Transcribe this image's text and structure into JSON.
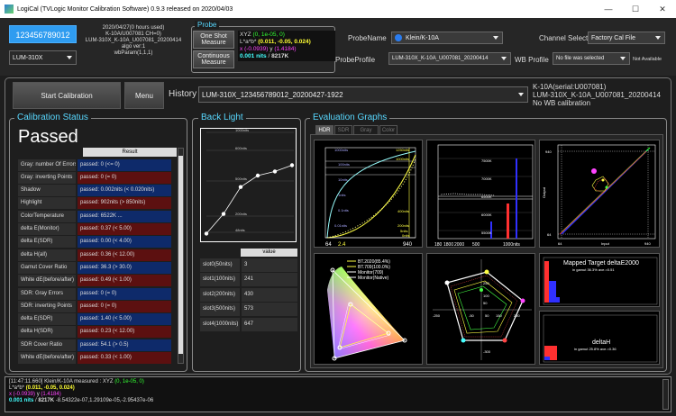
{
  "window": {
    "title": "LogiCal (TVLogic Monitor Calibration Software) 0.9.3 released on 2020/04/03"
  },
  "device": {
    "serial_button": "123456789012",
    "model": "LUM-310X",
    "info": [
      "2020/04/27(0 hours used)",
      "K-10A/U007081 CH=0)",
      "LUM-310X_K-10A_U007081_20200414",
      "algo ver:1",
      "wbParam(1,1,1)"
    ]
  },
  "probe": {
    "label": "Probe",
    "one_shot": "One Shot Measure",
    "continuous": "Continuous Measure",
    "line1_a": "XYZ ",
    "line1_b": "(0, 1e-05, 0)",
    "line2_a": "L*a*b* ",
    "line2_b": "(0.011, -0.05, 0.024)",
    "line3_a": "x ",
    "line3_b": "(-0.0939)",
    "line3_c": " y ",
    "line3_d": "(1.4184)",
    "line4_a": "0.001 nits",
    "line4_b": " / ",
    "line4_c": "8217K",
    "name_label": "ProbeName",
    "name_value": "Klein/K-10A",
    "profile_label": "ProbeProfile",
    "profile_value": "LUM-310X_K-10A_U007081_20200414",
    "channel_label": "Channel Select",
    "channel_value": "Factory Cal File",
    "wb_label": "WB Profile",
    "wb_value": "No file was selected",
    "wb_status": "Not Available"
  },
  "toolbar": {
    "start": "Start Calibration",
    "menu": "Menu",
    "history_label": "History",
    "history_value": "LUM-310X_123456789012_20200427-1922",
    "right_info": [
      "K-10A(serial:U007081)",
      "LUM-310X_K-10A_U007081_20200414",
      "No WB calibration"
    ]
  },
  "status": {
    "title": "Calibration Status",
    "result": "Passed",
    "col_header": "Result",
    "rows": [
      {
        "label": "Gray: number Of Errors",
        "value": "passed: 0 (<= 0)",
        "tone": "blue"
      },
      {
        "label": "Gray: inverting Points",
        "value": "passed: 0 (= 0)",
        "tone": "red"
      },
      {
        "label": "Shadow",
        "value": "passed: 0.002nits (< 0.020nits)",
        "tone": "blue"
      },
      {
        "label": "Highlight",
        "value": "passed: 902nits (> 850nits)",
        "tone": "red"
      },
      {
        "label": "ColorTemperature",
        "value": "passed: 6522K ...",
        "tone": "blue"
      },
      {
        "label": "delta E(Monitor)",
        "value": "passed: 0.37 (< 5.00)",
        "tone": "red"
      },
      {
        "label": "delta E(SDR)",
        "value": "passed: 0.00 (< 4.00)",
        "tone": "blue"
      },
      {
        "label": "delta H(all)",
        "value": "passed: 0.36 (< 12.00)",
        "tone": "red"
      },
      {
        "label": "Gamut Cover Ratio",
        "value": "passed: 36.3 (> 30.0)",
        "tone": "blue"
      },
      {
        "label": "White dE(before/after)",
        "value": "passed: 0.49 (< 1.00)",
        "tone": "red"
      },
      {
        "label": "SDR: Gray Errors",
        "value": "passed: 0 (= 0)",
        "tone": "blue"
      },
      {
        "label": "SDR: inverting Points",
        "value": "passed: 0 (= 0)",
        "tone": "red"
      },
      {
        "label": "delta E(SDR)",
        "value": "passed: 1.40 (< 5.00)",
        "tone": "blue"
      },
      {
        "label": "delta H(SDR)",
        "value": "passed: 0.23 (< 12.00)",
        "tone": "red"
      },
      {
        "label": "SDR Cover Ratio",
        "value": "passed: 54.1 (> 0.5)",
        "tone": "blue"
      },
      {
        "label": "White dE(before/after)",
        "value": "passed: 0.33 (< 1.00)",
        "tone": "red"
      }
    ]
  },
  "backlight": {
    "title": "Back Light",
    "levels": [
      "1000nits",
      "600nits",
      "500nits",
      "200nits",
      "48nits"
    ],
    "points": [
      0.04,
      0.23,
      0.49,
      0.6,
      0.64,
      0.7
    ],
    "col_header": "value",
    "rows": [
      {
        "label": "slot0(50nits)",
        "value": "3"
      },
      {
        "label": "slot1(100nits)",
        "value": "241"
      },
      {
        "label": "slot2(200nits)",
        "value": "430"
      },
      {
        "label": "slot3(500nits)",
        "value": "573"
      },
      {
        "label": "slot4(1000nits)",
        "value": "647"
      }
    ]
  },
  "graphs": {
    "title": "Evaluation Graphs",
    "tabs": [
      "HDR",
      "SDR",
      "Gray Scale",
      "Color"
    ],
    "g1": {
      "levels": [
        "1000nits",
        "100nits",
        "10nits",
        "1nits",
        "0.1nits",
        "0.01nits"
      ],
      "right": [
        "1250nits",
        "1000nits",
        "400nits",
        "200nits",
        "5nits",
        "0nits"
      ],
      "x": [
        "64",
        "2.4",
        "940"
      ]
    },
    "g2": {
      "levels": [
        "7500K",
        "7000K",
        "6500K",
        "6000K",
        "5500K"
      ],
      "x": [
        "180",
        "1800",
        "2000",
        "500",
        "1000nits"
      ]
    },
    "g3": {
      "ylabel": "Output",
      "xlabel": "Input",
      "ticks": [
        "940",
        "64",
        "64",
        "940"
      ]
    },
    "legend": [
      "BT.2020(85.4%)",
      "BT.709(100.0%)",
      "Monitor(709)",
      "Monitor(Native)"
    ],
    "g5": {
      "ticks": [
        "250",
        "100",
        "50",
        "-250",
        "-50",
        "50",
        "150",
        "250",
        "-300"
      ]
    },
    "g6": {
      "title": "Mapped Target deltaE2000",
      "sub": "in gamut 36.3% ave.=0.51"
    },
    "g7": {
      "title": "deltaH",
      "sub": "in gamut 25.8% ave.=0.36"
    }
  },
  "log": {
    "line1": "[11:47:11.660] Klein/K-10A measured : XYZ ",
    "line1b": "(0, 1e-05, 0)",
    "line2a": "L*a*b* ",
    "line2b": "(0.011, -0.05, 0.024)",
    "line3a": "x ",
    "line3b": "(-0.0939)",
    "line3c": " y ",
    "line3d": "(1.4184)",
    "line4a": "0.001 nits",
    "line4b": " / ",
    "line4c": "8217K",
    "line4d": " -8.54322e-07,1.29109e-05,-2.95437e-06"
  },
  "colors": {
    "accent": "#58d8ff",
    "blue_row": "#0e2a6a",
    "red_row": "#5c1010",
    "yellow": "#ffff33",
    "green": "#33ff33",
    "magenta": "#ff44ff",
    "cyan": "#44ffff"
  }
}
